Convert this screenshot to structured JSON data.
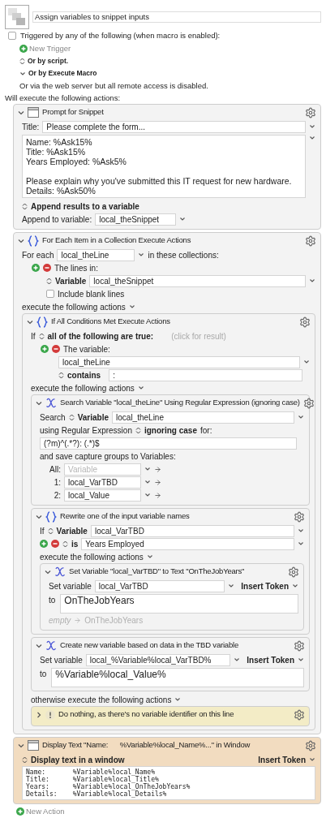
{
  "macro": {
    "name": "Assign variables to snippet inputs"
  },
  "triggers": {
    "label": "Triggered by any of the following (when macro is enabled):",
    "checked": false,
    "new_trigger": "New Trigger",
    "options": [
      {
        "label": "Or by script.",
        "kind": "popup"
      },
      {
        "label": "Or by Execute Macro",
        "kind": "disclosure"
      }
    ],
    "web_note": "Or via the web server but all remote access is disabled."
  },
  "actions_heading": "Will execute the following actions:",
  "actions": [
    {
      "kind": "prompt_snippet",
      "title": "Prompt for Snippet",
      "expanded": true,
      "title_label": "Title:",
      "title_value": "Please complete the form...",
      "snippet": "Name: %Ask15%\nTitle: %Ask15%\nYears Employed: %Ask5%\n\nPlease explain why you've submitted this IT request for new hardware.\nDetails: %Ask50%",
      "result_mode": "Append results to a variable",
      "variable_label": "Append to variable:",
      "variable": "local_theSnippet"
    },
    {
      "kind": "for_each",
      "title": "For Each Item in a Collection Execute Actions",
      "expanded": true,
      "for_each_label": "For each",
      "variable": "local_theLine",
      "collections_label": "in these collections:",
      "collections": [
        {
          "label": "The lines in:",
          "source": "Variable",
          "value": "local_theSnippet",
          "option": {
            "label": "Include blank lines",
            "checked": false
          }
        }
      ],
      "execute_label": "execute the following actions",
      "actions": [
        {
          "kind": "if_then",
          "title": "If All Conditions Met Execute Actions",
          "expanded": true,
          "if_label": "If",
          "match": "all of the following are true:",
          "result_hint": "(click for result)",
          "conditions": [
            {
              "label": "The variable:",
              "variable": "local_theLine",
              "operator": "contains",
              "value": ":"
            }
          ],
          "execute_label": "execute the following actions",
          "actions": [
            {
              "kind": "search_regex",
              "title": "Search Variable \"local_theLine\" Using Regular Expression (ignoring case)",
              "expanded": true,
              "search_label": "Search",
              "source": "Variable",
              "variable": "local_theLine",
              "using_label": "using Regular Expression",
              "case_mode": "ignoring case",
              "for_label": "for:",
              "pattern": "(?m)^(.*?): (.*)$",
              "save_label": "and save capture groups to Variables:",
              "groups": [
                {
                  "label": "All:",
                  "placeholder": "Variable"
                },
                {
                  "label": "1:",
                  "value": "local_VarTBD"
                },
                {
                  "label": "2:",
                  "value": "local_Value"
                }
              ]
            },
            {
              "kind": "if_variable",
              "title": "Rewrite one of the input variable names",
              "expanded": true,
              "if_label": "If",
              "source": "Variable",
              "variable": "local_VarTBD",
              "operator": "is",
              "value": "Years Employed",
              "execute_label": "execute the following actions",
              "actions": [
                {
                  "kind": "set_variable",
                  "title": "Set Variable \"local_VarTBD\" to Text \"OnTheJobYears\"",
                  "expanded": true,
                  "set_label": "Set variable",
                  "variable": "local_VarTBD",
                  "token_menu": "Insert Token",
                  "to_label": "to",
                  "text": "OnTheJobYears",
                  "preview_from": "empty",
                  "preview_to": "OnTheJobYears"
                }
              ]
            },
            {
              "kind": "set_variable",
              "title": "Create new variable based on data in the TBD variable",
              "expanded": true,
              "set_label": "Set variable",
              "variable": "local_%Variable%local_VarTBD%",
              "token_menu": "Insert Token",
              "to_label": "to",
              "text": "%Variable%local_Value%"
            }
          ],
          "otherwise_label": "otherwise execute the following actions",
          "else_actions": [
            {
              "kind": "comment",
              "title": "Do nothing, as there's no variable identifier on this line",
              "expanded": false,
              "color": "#f3ecc6"
            }
          ]
        }
      ]
    },
    {
      "kind": "display_text",
      "title": "Display Text \"Name:      %Variable%local_Name%...\" in Window",
      "expanded": true,
      "color": "#f2dcc0",
      "mode": "Display text in a window",
      "token_menu": "Insert Token",
      "text": "Name:       %Variable%local_Name%\nTitle:      %Variable%local_Title%\nYears:      %Variable%local_OnTheJobYears%\nDetails:    %Variable%local_Details%"
    }
  ],
  "new_action": "New Action"
}
